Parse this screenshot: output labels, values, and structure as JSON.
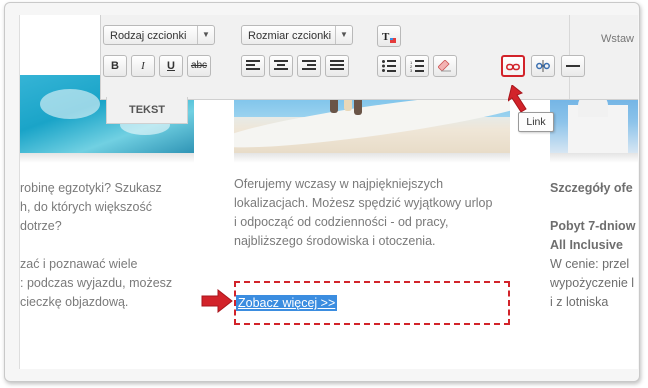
{
  "toolbar": {
    "font_family_select": "Rodzaj czcionki",
    "font_size_select": "Rozmiar czcionki",
    "bold": "B",
    "italic": "I",
    "underline": "U",
    "strike": "abc",
    "section_text_label": "TEKST",
    "section_insert_label": "Wstaw",
    "icons": [
      "bold-icon",
      "italic-icon",
      "underline-icon",
      "strikethrough-icon",
      "align-left-icon",
      "align-center-icon",
      "align-right-icon",
      "align-justify-icon",
      "bullet-list-icon",
      "numbered-list-icon",
      "eraser-icon",
      "text-color-icon",
      "link-icon",
      "unlink-icon",
      "horizontal-rule-icon"
    ]
  },
  "tooltip": {
    "link": "Link"
  },
  "content": {
    "left_lines": [
      "robinę egzotyki? Szukasz",
      "h, do których większość",
      "dotrze?",
      "",
      "zać i poznawać wiele",
      ": podczas wyjazdu, możesz",
      "cieczkę objazdową."
    ],
    "mid_lines": [
      "Oferujemy wczasy w najpiękniejszych",
      "lokalizacjach. Możesz spędzić wyjątkowy urlop",
      "i odpocząć od codzienności - od pracy,",
      "najbliższego środowiska i otoczenia."
    ],
    "right_lines": [
      "Szczegóły ofe",
      "",
      "Pobyt 7-dniow",
      "All Inclusive",
      "W cenie: przel",
      "wypożyczenie l",
      "i z lotniska"
    ],
    "link_text": "Zobacz więcej >>"
  },
  "colors": {
    "highlight": "#3b8de0",
    "annotation_red": "#d2232a"
  }
}
